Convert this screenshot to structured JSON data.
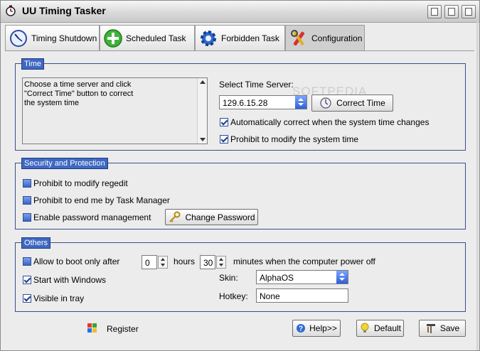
{
  "window": {
    "title": "UU Timing Tasker"
  },
  "tabs": [
    {
      "label": "Timing Shutdown",
      "icon": "clock-icon"
    },
    {
      "label": "Scheduled Task",
      "icon": "add-icon"
    },
    {
      "label": "Forbidden Task",
      "icon": "gear-icon"
    },
    {
      "label": "Configuration",
      "icon": "tools-icon"
    }
  ],
  "time": {
    "group_title": "Time",
    "help_text": "Choose a time server and click\n\"Correct Time\" button to correct\nthe system time",
    "server_label": "Select Time Server:",
    "server_value": "129.6.15.28",
    "correct_button": "Correct Time",
    "auto_correct": {
      "label": "Automatically correct when the system time changes",
      "checked": true
    },
    "prohibit_modify": {
      "label": "Prohibit to modify the system time",
      "checked": true
    }
  },
  "security": {
    "group_title": "Security and Protection",
    "regedit": {
      "label": "Prohibit to modify regedit",
      "checked": false
    },
    "task_manager": {
      "label": "Prohibit to end me by Task Manager",
      "checked": false
    },
    "password": {
      "label": "Enable password management",
      "checked": false
    },
    "change_password_button": "Change Password"
  },
  "others": {
    "group_title": "Others",
    "boot_only": {
      "label": "Allow to boot only after",
      "checked": false
    },
    "hours_value": "0",
    "hours_label": "hours",
    "minutes_value": "30",
    "minutes_label": "minutes when the computer power off",
    "start_windows": {
      "label": "Start with Windows",
      "checked": true
    },
    "visible_tray": {
      "label": "Visible in tray",
      "checked": true
    },
    "skin_label": "Skin:",
    "skin_value": "AlphaOS",
    "hotkey_label": "Hotkey:",
    "hotkey_value": "None"
  },
  "footer": {
    "register": "Register",
    "help": "Help>>",
    "default": "Default",
    "save": "Save"
  },
  "watermark": "SOFTPEDIA"
}
